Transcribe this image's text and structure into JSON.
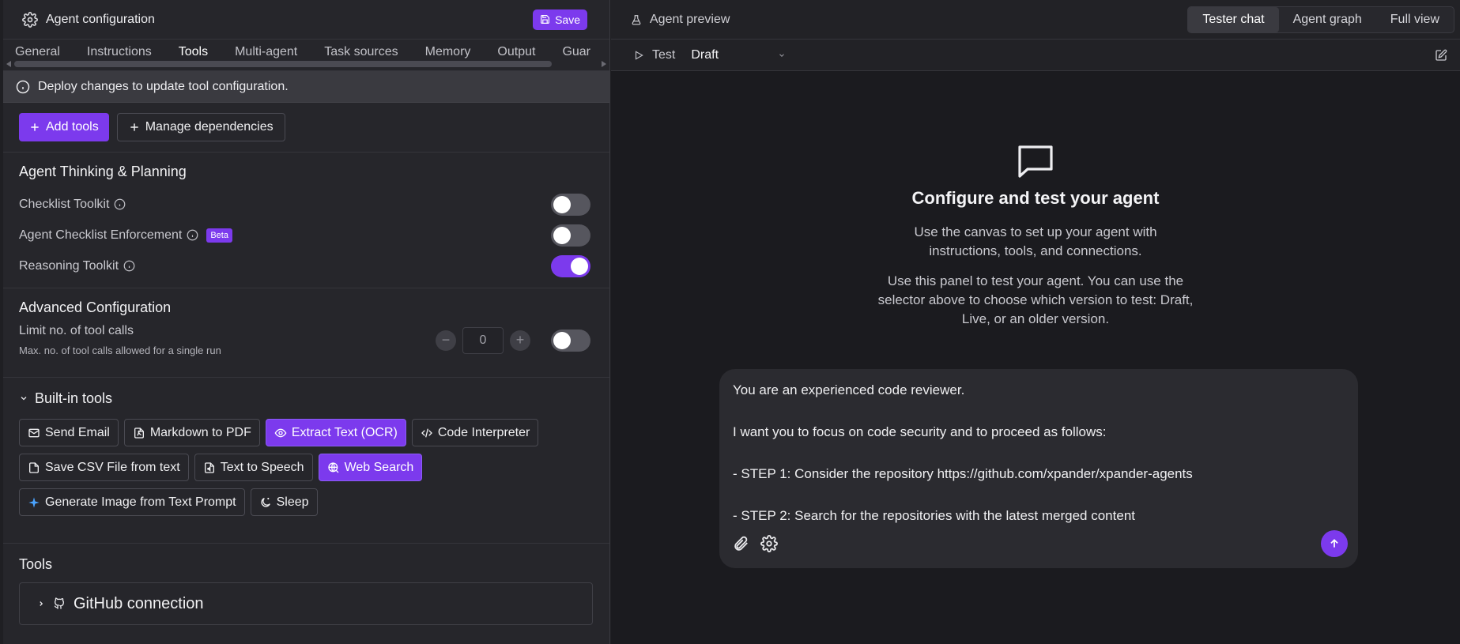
{
  "config": {
    "title": "Agent configuration",
    "save_label": "Save",
    "tabs": [
      "General",
      "Instructions",
      "Tools",
      "Multi-agent",
      "Task sources",
      "Memory",
      "Output",
      "Guar"
    ],
    "active_tab": "Tools",
    "notice": "Deploy changes to update tool configuration.",
    "add_tools_label": "Add tools",
    "manage_deps_label": "Manage dependencies",
    "thinking": {
      "title": "Agent Thinking & Planning",
      "items": [
        {
          "label": "Checklist Toolkit",
          "enabled": false
        },
        {
          "label": "Agent Checklist Enforcement",
          "badge": "Beta",
          "enabled": false
        },
        {
          "label": "Reasoning Toolkit",
          "enabled": true
        }
      ]
    },
    "advanced": {
      "title": "Advanced Configuration",
      "limit_label": "Limit no. of tool calls",
      "limit_desc": "Max. no. of tool calls allowed for a single run",
      "limit_value": "0",
      "minus": "−",
      "plus": "+",
      "enabled": false
    },
    "builtin": {
      "title": "Built-in tools",
      "chips": [
        {
          "label": "Send Email",
          "icon": "mail-icon",
          "active": false
        },
        {
          "label": "Markdown to PDF",
          "icon": "file-pdf-icon",
          "active": false
        },
        {
          "label": "Extract Text (OCR)",
          "icon": "eye-icon",
          "active": true
        },
        {
          "label": "Code Interpreter",
          "icon": "code-icon",
          "active": false
        },
        {
          "label": "Save CSV File from text",
          "icon": "file-icon",
          "active": false
        },
        {
          "label": "Text to Speech",
          "icon": "file-audio-icon",
          "active": false
        },
        {
          "label": "Web Search",
          "icon": "globe-icon",
          "active": true
        },
        {
          "label": "Generate Image from Text Prompt",
          "icon": "sparkle-icon",
          "active": false
        },
        {
          "label": "Sleep",
          "icon": "moon-icon",
          "active": false
        }
      ]
    },
    "tools": {
      "title": "Tools",
      "connection": "GitHub connection"
    }
  },
  "preview": {
    "title": "Agent preview",
    "view_tabs": [
      "Tester chat",
      "Agent graph",
      "Full view"
    ],
    "active_view": "Tester chat",
    "test_label": "Test",
    "version": "Draft",
    "heading": "Configure and test your agent",
    "para1": "Use the canvas to set up your agent with instructions, tools, and connections.",
    "para2": "Use this panel to test your agent. You can use the selector above to choose which version to test: Draft, Live, or an older version.",
    "message": "You are an experienced code reviewer.\n\nI want you to focus on code security and to proceed as follows:\n\n- STEP 1: Consider the repository https://github.com/xpander/xpander-agents\n\n- STEP 2: Search for the repositories with the latest merged content"
  },
  "colors": {
    "accent": "#7c3aed",
    "background": "#1b1b1f",
    "panel": "#26262b"
  }
}
